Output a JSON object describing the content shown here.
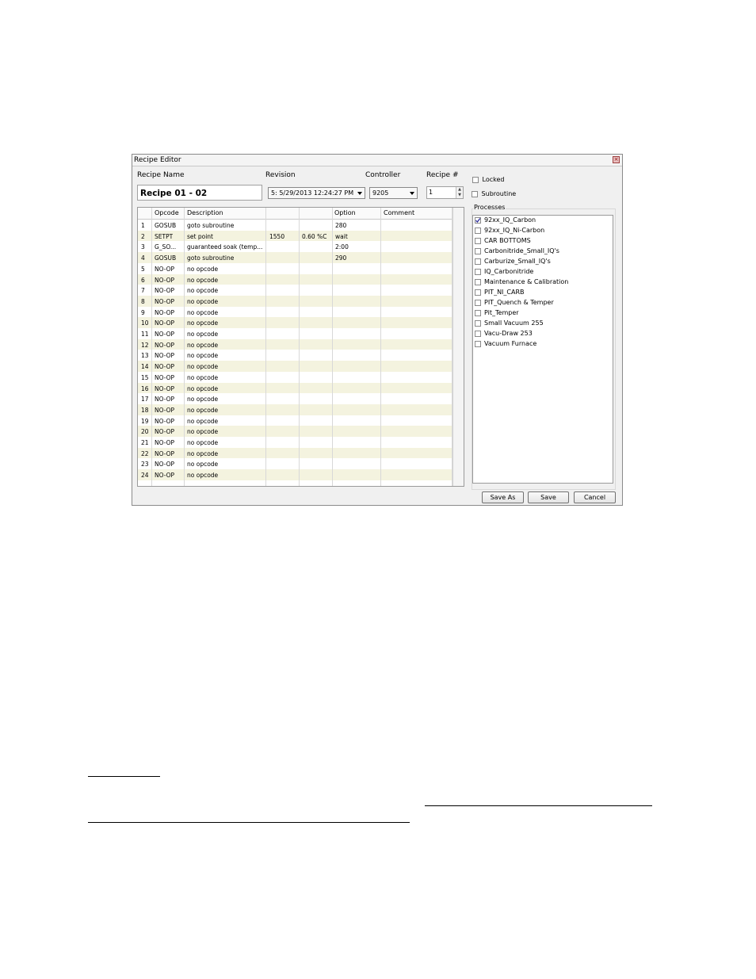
{
  "window": {
    "title": "Recipe Editor"
  },
  "form": {
    "recipe_name_label": "Recipe Name",
    "recipe_name_value": "Recipe 01 - 02",
    "revision_label": "Revision",
    "revision_value": "5: 5/29/2013 12:24:27 PM",
    "controller_label": "Controller",
    "controller_value": "9205",
    "recipe_num_label": "Recipe #",
    "recipe_num_value": "1",
    "locked_label": "Locked",
    "locked_checked": false,
    "subroutine_label": "Subroutine",
    "subroutine_checked": false
  },
  "grid": {
    "headers": {
      "num": "",
      "opcode": "Opcode",
      "description": "Description",
      "c3": "",
      "c4": "",
      "option": "Option",
      "comment": "Comment"
    },
    "rows": [
      {
        "num": "1",
        "opcode": "GOSUB",
        "description": "goto subroutine",
        "c3": "",
        "c4": "",
        "option": "280",
        "comment": ""
      },
      {
        "num": "2",
        "opcode": "SETPT",
        "description": "set point",
        "c3": "1550",
        "c4": "0.60 %C",
        "option": "wait",
        "comment": ""
      },
      {
        "num": "3",
        "opcode": "G_SO...",
        "description": "guaranteed soak (temp...",
        "c3": "",
        "c4": "",
        "option": "2:00",
        "comment": ""
      },
      {
        "num": "4",
        "opcode": "GOSUB",
        "description": "goto subroutine",
        "c3": "",
        "c4": "",
        "option": "290",
        "comment": ""
      },
      {
        "num": "5",
        "opcode": "NO-OP",
        "description": "no opcode",
        "c3": "",
        "c4": "",
        "option": "",
        "comment": ""
      },
      {
        "num": "6",
        "opcode": "NO-OP",
        "description": "no opcode",
        "c3": "",
        "c4": "",
        "option": "",
        "comment": ""
      },
      {
        "num": "7",
        "opcode": "NO-OP",
        "description": "no opcode",
        "c3": "",
        "c4": "",
        "option": "",
        "comment": ""
      },
      {
        "num": "8",
        "opcode": "NO-OP",
        "description": "no opcode",
        "c3": "",
        "c4": "",
        "option": "",
        "comment": ""
      },
      {
        "num": "9",
        "opcode": "NO-OP",
        "description": "no opcode",
        "c3": "",
        "c4": "",
        "option": "",
        "comment": ""
      },
      {
        "num": "10",
        "opcode": "NO-OP",
        "description": "no opcode",
        "c3": "",
        "c4": "",
        "option": "",
        "comment": ""
      },
      {
        "num": "11",
        "opcode": "NO-OP",
        "description": "no opcode",
        "c3": "",
        "c4": "",
        "option": "",
        "comment": ""
      },
      {
        "num": "12",
        "opcode": "NO-OP",
        "description": "no opcode",
        "c3": "",
        "c4": "",
        "option": "",
        "comment": ""
      },
      {
        "num": "13",
        "opcode": "NO-OP",
        "description": "no opcode",
        "c3": "",
        "c4": "",
        "option": "",
        "comment": ""
      },
      {
        "num": "14",
        "opcode": "NO-OP",
        "description": "no opcode",
        "c3": "",
        "c4": "",
        "option": "",
        "comment": ""
      },
      {
        "num": "15",
        "opcode": "NO-OP",
        "description": "no opcode",
        "c3": "",
        "c4": "",
        "option": "",
        "comment": ""
      },
      {
        "num": "16",
        "opcode": "NO-OP",
        "description": "no opcode",
        "c3": "",
        "c4": "",
        "option": "",
        "comment": ""
      },
      {
        "num": "17",
        "opcode": "NO-OP",
        "description": "no opcode",
        "c3": "",
        "c4": "",
        "option": "",
        "comment": ""
      },
      {
        "num": "18",
        "opcode": "NO-OP",
        "description": "no opcode",
        "c3": "",
        "c4": "",
        "option": "",
        "comment": ""
      },
      {
        "num": "19",
        "opcode": "NO-OP",
        "description": "no opcode",
        "c3": "",
        "c4": "",
        "option": "",
        "comment": ""
      },
      {
        "num": "20",
        "opcode": "NO-OP",
        "description": "no opcode",
        "c3": "",
        "c4": "",
        "option": "",
        "comment": ""
      },
      {
        "num": "21",
        "opcode": "NO-OP",
        "description": "no opcode",
        "c3": "",
        "c4": "",
        "option": "",
        "comment": ""
      },
      {
        "num": "22",
        "opcode": "NO-OP",
        "description": "no opcode",
        "c3": "",
        "c4": "",
        "option": "",
        "comment": ""
      },
      {
        "num": "23",
        "opcode": "NO-OP",
        "description": "no opcode",
        "c3": "",
        "c4": "",
        "option": "",
        "comment": ""
      },
      {
        "num": "24",
        "opcode": "NO-OP",
        "description": "no opcode",
        "c3": "",
        "c4": "",
        "option": "",
        "comment": ""
      }
    ]
  },
  "processes": {
    "title": "Processes",
    "items": [
      {
        "label": "92xx_IQ_Carbon",
        "checked": true
      },
      {
        "label": "92xx_IQ_Ni-Carbon",
        "checked": false
      },
      {
        "label": "CAR BOTTOMS",
        "checked": false
      },
      {
        "label": "Carbonitride_Small_IQ's",
        "checked": false
      },
      {
        "label": "Carburize_Small_IQ's",
        "checked": false
      },
      {
        "label": "IQ_Carbonitride",
        "checked": false
      },
      {
        "label": "Maintenance & Calibration",
        "checked": false
      },
      {
        "label": "PIT_NI_CARB",
        "checked": false
      },
      {
        "label": "PIT_Quench & Temper",
        "checked": false
      },
      {
        "label": "Pit_Temper",
        "checked": false
      },
      {
        "label": "Small Vacuum 255",
        "checked": false
      },
      {
        "label": "Vacu-Draw 253",
        "checked": false
      },
      {
        "label": "Vacuum Furnace",
        "checked": false
      }
    ]
  },
  "buttons": {
    "save_as": "Save As",
    "save": "Save",
    "cancel": "Cancel"
  },
  "colors": {
    "row_alt": "#f4f3df",
    "dialog_bg": "#f0f0f0"
  }
}
